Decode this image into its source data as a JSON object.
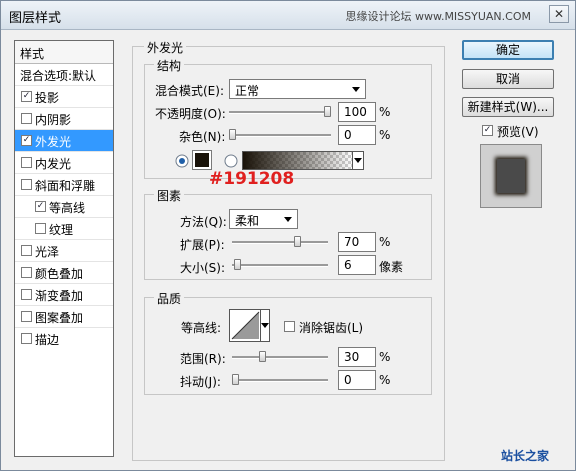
{
  "dialog_title": "图层样式",
  "watermark_top": "思缘设计论坛 www.MISSYUAN.COM",
  "watermark_bottom": "站长之家",
  "annotation_hex": "#191208",
  "colors": {
    "glow_color": "#191208",
    "selected_row": "#3399ff",
    "annotation": "#e0201f"
  },
  "left_panel": {
    "header": "样式",
    "blend_options": "混合选项:默认",
    "items": [
      {
        "label": "投影",
        "checked": "✓"
      },
      {
        "label": "内阴影",
        "checked": ""
      },
      {
        "label": "外发光",
        "checked": "✓"
      },
      {
        "label": "内发光",
        "checked": ""
      },
      {
        "label": "斜面和浮雕",
        "checked": ""
      },
      {
        "label": "等高线",
        "checked": "✓"
      },
      {
        "label": "纹理",
        "checked": ""
      },
      {
        "label": "光泽",
        "checked": ""
      },
      {
        "label": "颜色叠加",
        "checked": ""
      },
      {
        "label": "渐变叠加",
        "checked": ""
      },
      {
        "label": "图案叠加",
        "checked": ""
      },
      {
        "label": "描边",
        "checked": ""
      }
    ]
  },
  "outer_glow": {
    "section_title": "外发光",
    "structure": {
      "title": "结构",
      "blend_mode_label": "混合模式(E):",
      "blend_mode_value": "正常",
      "opacity_label": "不透明度(O):",
      "opacity_value": "100",
      "opacity_fraction": 1.0,
      "noise_label": "杂色(N):",
      "noise_value": "0",
      "noise_fraction": 0.0,
      "percent": "%"
    },
    "elements": {
      "title": "图素",
      "technique_label": "方法(Q):",
      "technique_value": "柔和",
      "spread_label": "扩展(P):",
      "spread_value": "70",
      "spread_fraction": 0.7,
      "size_label": "大小(S):",
      "size_value": "6",
      "size_fraction": 0.024,
      "size_unit": "像素",
      "percent": "%"
    },
    "quality": {
      "title": "品质",
      "contour_label": "等高线:",
      "antialias_label": "消除锯齿(L)",
      "range_label": "范围(R):",
      "range_value": "30",
      "range_fraction": 0.3,
      "jitter_label": "抖动(J):",
      "jitter_value": "0",
      "jitter_fraction": 0.0,
      "percent": "%"
    }
  },
  "buttons": {
    "ok": "确定",
    "cancel": "取消",
    "new_style": "新建样式(W)...",
    "preview_label": "预览(V)",
    "preview_checked": "✓"
  }
}
